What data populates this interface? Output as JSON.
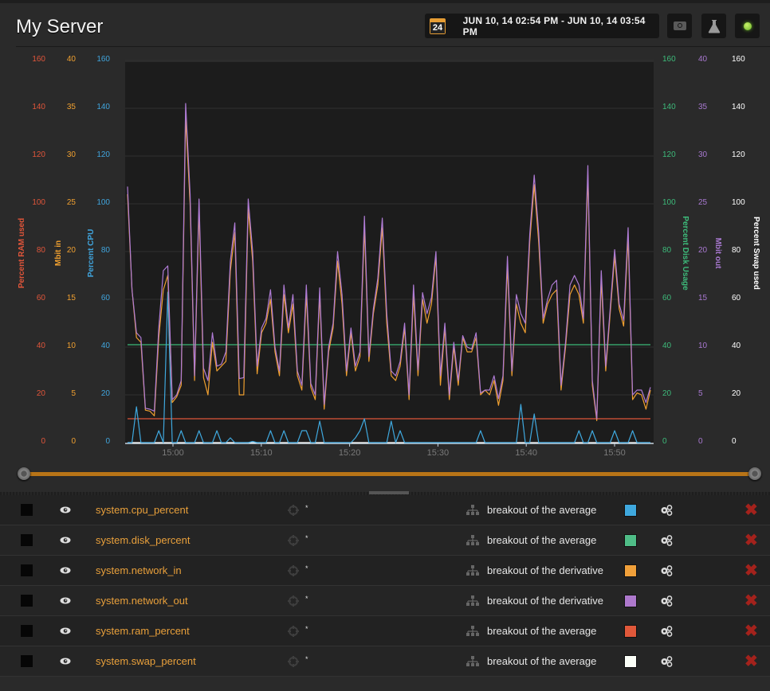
{
  "header": {
    "title": "My Server",
    "calendar_day": "24",
    "date_range": "JUN 10, 14 02:54 PM - JUN 10, 14 03:54 PM",
    "buttons": [
      {
        "name": "snapshot",
        "icon": "camera-icon"
      },
      {
        "name": "lab",
        "icon": "flask-icon"
      },
      {
        "name": "status",
        "icon": "status-light-icon",
        "color": "#7dc832"
      }
    ]
  },
  "chart_data": {
    "type": "line",
    "title": "",
    "xlabel": "",
    "x_ticks": [
      "15:00",
      "15:10",
      "15:20",
      "15:30",
      "15:40",
      "15:50"
    ],
    "x_range": [
      "14:54:30",
      "15:54:00"
    ],
    "grid": true,
    "axes": {
      "left": [
        {
          "id": "ram",
          "label": "Percent RAM used",
          "color": "#e0553a",
          "range": [
            0,
            160
          ],
          "ticks": [
            "0",
            "20",
            "40",
            "60",
            "80",
            "100",
            "120",
            "140",
            "160"
          ]
        },
        {
          "id": "net_in",
          "label": "Mbit in",
          "color": "#f0a030",
          "range": [
            0,
            40
          ],
          "ticks": [
            "0",
            "5",
            "10",
            "15",
            "20",
            "25",
            "30",
            "35",
            "40"
          ]
        },
        {
          "id": "cpu",
          "label": "Percent CPU",
          "color": "#40a4dc",
          "range": [
            0,
            160
          ],
          "ticks": [
            "0",
            "20",
            "40",
            "60",
            "80",
            "100",
            "120",
            "140",
            "160"
          ]
        }
      ],
      "right": [
        {
          "id": "disk",
          "label": "Percent Disk Usage",
          "color": "#3dba7a",
          "range": [
            0,
            160
          ],
          "ticks": [
            "0",
            "20",
            "40",
            "60",
            "80",
            "100",
            "120",
            "140",
            "160"
          ]
        },
        {
          "id": "net_out",
          "label": "Mbit out",
          "color": "#a878d0",
          "range": [
            0,
            40
          ],
          "ticks": [
            "0",
            "5",
            "10",
            "15",
            "20",
            "25",
            "30",
            "35",
            "40"
          ]
        },
        {
          "id": "swap",
          "label": "Percent Swap used",
          "color": "#ffffff",
          "range": [
            0,
            160
          ],
          "ticks": [
            "0",
            "20",
            "40",
            "60",
            "80",
            "100",
            "120",
            "140",
            "160"
          ]
        }
      ]
    },
    "x_minutes_from": "14:54:30",
    "series": [
      {
        "name": "system.network_out",
        "axis": "net_out",
        "color": "#b07cd6",
        "values": [
          26.8,
          16,
          11.5,
          11,
          3.6,
          3.5,
          3.3,
          12,
          18,
          18.5,
          4.5,
          5,
          6.5,
          35.5,
          26,
          7,
          25.5,
          7.8,
          6.5,
          11.5,
          8,
          8.2,
          9.5,
          19,
          23,
          6.7,
          6.8,
          25.5,
          20,
          8,
          12,
          13,
          16,
          10,
          7.5,
          16.5,
          12,
          15.5,
          7.5,
          6,
          16.5,
          6.2,
          5,
          16.2,
          4,
          10,
          12.5,
          20,
          15.5,
          7.5,
          12,
          8,
          9.5,
          23.7,
          9,
          14,
          17.2,
          23.5,
          13.5,
          7.5,
          7,
          8.5,
          12.5,
          5,
          16.5,
          7.6,
          15.7,
          13.5,
          15.2,
          20,
          7,
          12.5,
          5,
          10.5,
          6.5,
          11.2,
          10,
          9.8,
          11.5,
          5.2,
          5.5,
          5.5,
          7,
          4.6,
          7,
          19.5,
          7.5,
          15.5,
          13.5,
          12.5,
          21.8,
          28,
          22,
          13,
          15,
          16.5,
          17,
          6,
          10.5,
          16.5,
          17.5,
          16.5,
          13,
          29,
          6.5,
          2.5,
          18,
          8,
          14,
          20.2,
          14.5,
          12.8,
          22.5,
          5,
          5.5,
          5.5,
          4.2,
          5.8
        ]
      },
      {
        "name": "system.network_in",
        "axis": "net_in",
        "color": "#f0a030",
        "values": [
          26,
          16,
          11,
          10.5,
          3.4,
          3.3,
          2.8,
          11,
          16,
          17.5,
          4.2,
          4.8,
          6,
          34,
          25,
          6.5,
          24.5,
          6.8,
          5,
          10.5,
          7.5,
          8,
          8.5,
          18,
          22,
          5,
          5,
          24.5,
          19,
          7.2,
          11.5,
          12.5,
          15,
          9.5,
          7,
          15.5,
          11.5,
          14.5,
          7,
          5.5,
          15.5,
          5.8,
          4.5,
          15.5,
          3.5,
          9.5,
          12,
          19,
          14.5,
          7,
          11.5,
          7.5,
          9,
          22.5,
          8.5,
          13.5,
          16.5,
          22.5,
          12.5,
          7,
          6.5,
          8,
          12,
          4.5,
          15.5,
          7,
          15,
          12.5,
          14.5,
          19.5,
          6,
          12,
          4.5,
          10,
          6,
          11,
          9.5,
          9.5,
          11,
          5,
          5.5,
          5,
          6.5,
          3.9,
          6.5,
          18.5,
          7,
          14.5,
          12.5,
          11.5,
          21,
          27,
          21,
          12.5,
          14.5,
          15.5,
          16,
          5.5,
          10,
          15.5,
          16.5,
          15.5,
          12.5,
          28,
          6,
          2.3,
          17,
          7.5,
          13.5,
          19.5,
          14,
          12.2,
          21.5,
          4.5,
          5.2,
          5,
          3.5,
          5.5
        ]
      },
      {
        "name": "system.cpu_percent",
        "axis": "cpu",
        "color": "#3fa8de",
        "values": [
          0,
          0,
          15,
          0,
          0,
          0,
          0,
          5,
          0,
          63,
          0,
          0,
          5,
          0,
          0,
          0,
          5,
          0,
          0,
          0,
          5,
          0,
          0,
          2,
          0,
          0,
          0,
          0,
          0.5,
          0,
          0,
          0,
          5,
          0,
          0,
          5,
          0,
          0,
          0,
          5,
          5,
          0,
          0,
          9,
          0,
          0,
          0,
          0,
          0,
          0,
          0,
          2,
          5,
          10,
          0,
          0,
          0,
          0,
          0,
          9,
          0,
          5,
          0,
          0,
          0,
          0,
          0,
          0,
          0,
          0,
          0,
          0,
          0,
          0,
          0,
          0,
          0,
          0,
          0,
          5,
          0,
          0,
          0,
          0,
          0,
          0,
          0,
          0,
          16,
          0,
          0,
          12,
          0,
          0,
          0,
          0,
          0,
          0,
          0,
          0,
          0,
          5,
          0,
          0,
          5,
          0,
          0,
          0,
          0,
          5,
          0,
          0,
          0,
          5,
          0,
          0,
          0,
          0
        ]
      },
      {
        "name": "system.disk_percent",
        "axis": "disk",
        "color": "#3dba7a",
        "values_constant": 41
      },
      {
        "name": "system.ram_percent",
        "axis": "ram",
        "color": "#e0553a",
        "values_constant": 10
      },
      {
        "name": "system.swap_percent",
        "axis": "swap",
        "color": "#ffffff",
        "values_constant": 0
      }
    ]
  },
  "range_slider": {
    "start_fraction": 0,
    "end_fraction": 1
  },
  "metrics": [
    {
      "name": "system.cpu_percent",
      "filter": "*",
      "aggregation": "breakout of the average",
      "color": "#3fa8de"
    },
    {
      "name": "system.disk_percent",
      "filter": "*",
      "aggregation": "breakout of the average",
      "color": "#4fbd87"
    },
    {
      "name": "system.network_in",
      "filter": "*",
      "aggregation": "breakout of the derivative",
      "color": "#f0a03a"
    },
    {
      "name": "system.network_out",
      "filter": "*",
      "aggregation": "breakout of the derivative",
      "color": "#ad78cc"
    },
    {
      "name": "system.ram_percent",
      "filter": "*",
      "aggregation": "breakout of the average",
      "color": "#e0583a"
    },
    {
      "name": "system.swap_percent",
      "filter": "*",
      "aggregation": "breakout of the average",
      "color": "#fbfff8"
    }
  ]
}
